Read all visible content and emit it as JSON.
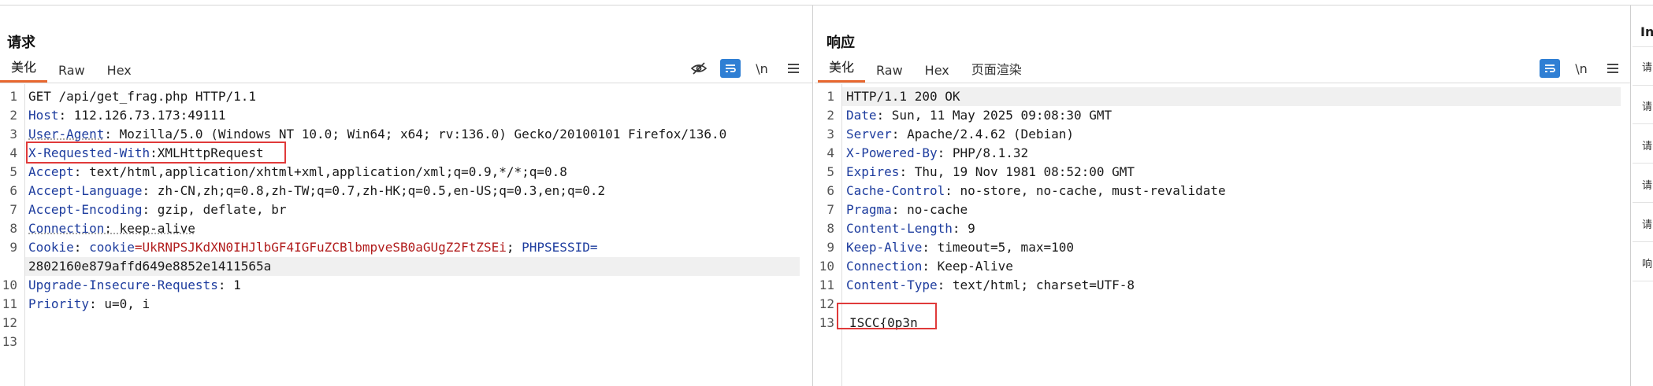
{
  "request": {
    "title": "请求",
    "tabs": [
      "美化",
      "Raw",
      "Hex"
    ],
    "lines": [
      {
        "n": "1",
        "header": "",
        "rest": "GET /api/get_frag.php HTTP/1.1"
      },
      {
        "n": "2",
        "header": "Host",
        "rest": ": 112.126.73.173:49111"
      },
      {
        "n": "3",
        "header": "User-Agent",
        "rest": ": Mozilla/5.0 (Windows NT 10.0; Win64; x64; rv:136.0) Gecko/20100101 Firefox/136.0"
      },
      {
        "n": "4",
        "header": "X-Requested-With",
        "rest": ":XMLHttpRequest"
      },
      {
        "n": "5",
        "header": "Accept",
        "rest": ": text/html,application/xhtml+xml,application/xml;q=0.9,*/*;q=0.8"
      },
      {
        "n": "6",
        "header": "Accept-Language",
        "rest": ": zh-CN,zh;q=0.8,zh-TW;q=0.7,zh-HK;q=0.5,en-US;q=0.3,en;q=0.2"
      },
      {
        "n": "7",
        "header": "Accept-Encoding",
        "rest": ": gzip, deflate, br"
      },
      {
        "n": "8",
        "header": "Connection",
        "rest": ": keep-alive"
      },
      {
        "n": "10",
        "header": "Upgrade-Insecure-Requests",
        "rest": ": 1"
      },
      {
        "n": "11",
        "header": "Priority",
        "rest": ": u=0, i"
      },
      {
        "n": "12",
        "header": "",
        "rest": ""
      },
      {
        "n": "13",
        "header": "",
        "rest": ""
      }
    ],
    "cookie": {
      "n": "9",
      "header": "Cookie",
      "sep": ": ",
      "k1": "cookie",
      "v1": "=UkRNPSJKdXN0IHJlbGF4IGFuZCBlbmpveSB0aGUgZ2FtZSEi",
      "semi": "; ",
      "k2": "PHPSESSID",
      "eq": "=",
      "v2": "2802160e879affd649e8852e1411565a"
    }
  },
  "response": {
    "title": "响应",
    "tabs": [
      "美化",
      "Raw",
      "Hex",
      "页面渲染"
    ],
    "lines": [
      {
        "n": "1",
        "header": "",
        "rest": "HTTP/1.1 200 OK"
      },
      {
        "n": "2",
        "header": "Date",
        "rest": ": Sun, 11 May 2025 09:08:30 GMT"
      },
      {
        "n": "3",
        "header": "Server",
        "rest": ": Apache/2.4.62 (Debian)"
      },
      {
        "n": "4",
        "header": "X-Powered-By",
        "rest": ": PHP/8.1.32"
      },
      {
        "n": "5",
        "header": "Expires",
        "rest": ": Thu, 19 Nov 1981 08:52:00 GMT"
      },
      {
        "n": "6",
        "header": "Cache-Control",
        "rest": ": no-store, no-cache, must-revalidate"
      },
      {
        "n": "7",
        "header": "Pragma",
        "rest": ": no-cache"
      },
      {
        "n": "8",
        "header": "Content-Length",
        "rest": ": 9"
      },
      {
        "n": "9",
        "header": "Keep-Alive",
        "rest": ": timeout=5, max=100"
      },
      {
        "n": "10",
        "header": "Connection",
        "rest": ": Keep-Alive"
      },
      {
        "n": "11",
        "header": "Content-Type",
        "rest": ": text/html; charset=UTF-8"
      },
      {
        "n": "12",
        "header": "",
        "rest": ""
      },
      {
        "n": "13",
        "header": "",
        "rest": "ISCC{0p3n"
      }
    ]
  },
  "toolbar": {
    "newline_label": "\\n"
  },
  "sidebar": {
    "head": "In",
    "items": [
      "请",
      "请",
      "请",
      "请",
      "请",
      "响"
    ]
  },
  "colors": {
    "accent_tab": "#e8672f",
    "blue_button": "#2f7fd4",
    "highlight_box": "#e03a3a",
    "header_name": "#1d3c9e",
    "cookie_value": "#b11d1d"
  }
}
